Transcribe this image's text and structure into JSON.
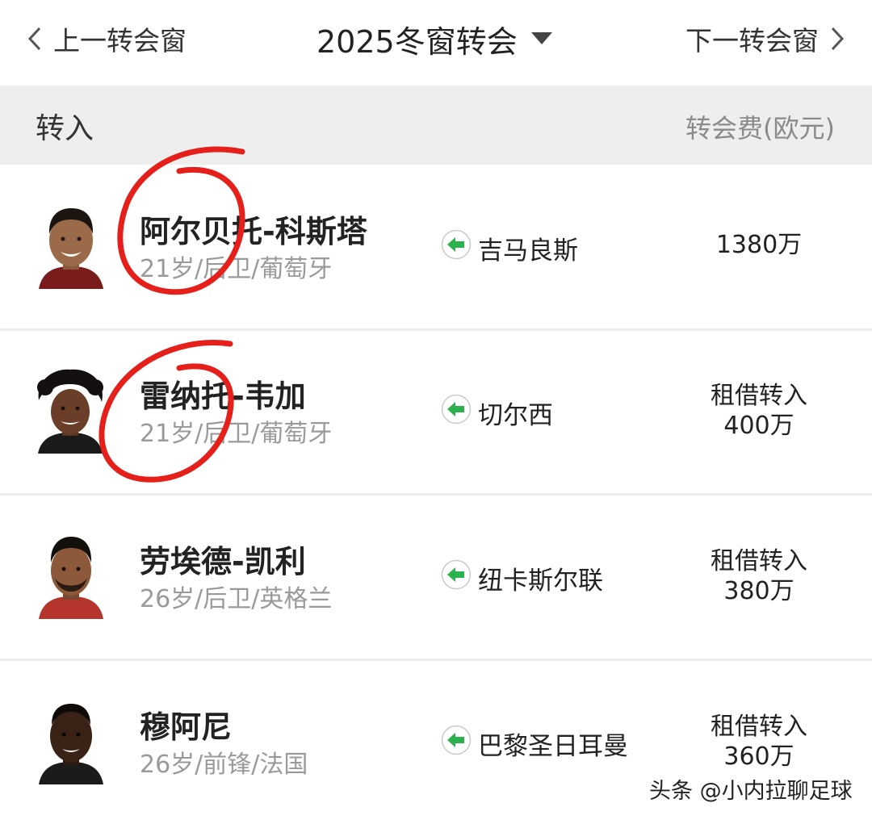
{
  "nav": {
    "prev_label": "上一转会窗",
    "title": "2025冬窗转会",
    "next_label": "下一转会窗"
  },
  "section": {
    "title": "转入",
    "fee_header": "转会费(欧元)"
  },
  "transfers": [
    {
      "name": "阿尔贝托-科斯塔",
      "meta": "21岁/后卫/葡萄牙",
      "club": "吉马良斯",
      "fee_line1": "",
      "fee_line2": "1380万"
    },
    {
      "name": "雷纳托-韦加",
      "meta": "21岁/后卫/葡萄牙",
      "club": "切尔西",
      "fee_line1": "租借转入",
      "fee_line2": "400万"
    },
    {
      "name": "劳埃德-凯利",
      "meta": "26岁/后卫/英格兰",
      "club": "纽卡斯尔联",
      "fee_line1": "租借转入",
      "fee_line2": "380万"
    },
    {
      "name": "穆阿尼",
      "meta": "26岁/前锋/法国",
      "club": "巴黎圣日耳曼",
      "fee_line1": "租借转入",
      "fee_line2": "360万"
    }
  ],
  "watermark": "头条 @小内拉聊足球",
  "colors": {
    "arrow_green": "#2bb24c",
    "annotation_red": "#e5201b",
    "header_bg": "#eeeeee"
  },
  "icons": {
    "prev": "chevron-left-icon",
    "next": "chevron-right-icon",
    "title_dropdown": "caret-down-icon",
    "transfer_in": "arrow-left-circle-icon"
  }
}
